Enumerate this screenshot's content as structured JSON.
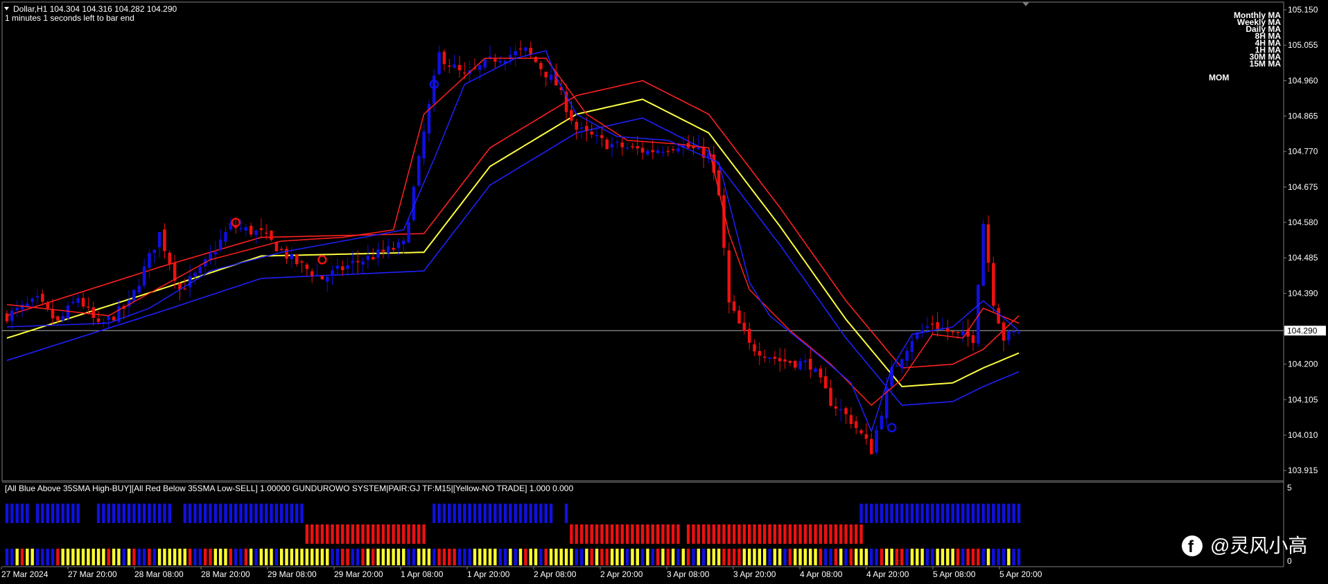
{
  "header": {
    "symbol_line": "Dollar,H1  104.304 104.316 104.282 104.290",
    "timer_line": "1 minutes 1 seconds left to bar end"
  },
  "indicator_header": "[All Blue Above 35SMA High-BUY][All Red Below 35SMA Low-SELL] 1.00000  GUNDUROWO SYSTEM|PAIR:GJ TF:M15|[Yellow-NO TRADE] 1.000 0.000",
  "legend": {
    "items": [
      "Monthly MA",
      "Weekly MA",
      "Daily MA",
      "8H MA",
      "4H MA",
      "1H MA",
      "30M MA",
      "15M MA"
    ],
    "mom": "MOM"
  },
  "sub_axis": {
    "top": "5",
    "bottom": "0"
  },
  "watermark": "@灵风小高",
  "colors": {
    "bull": "#1010e0",
    "bear": "#ee1010",
    "yellow": "#ffff30",
    "ma_blue": "#2020ff",
    "ma_red": "#ff2020",
    "ma_yellow": "#ffff40",
    "grid_line": "#b0b0b0"
  },
  "chart_data": {
    "type": "candlestick",
    "title": "Dollar,H1",
    "y_ticks": [
      "105.150",
      "105.055",
      "104.960",
      "104.865",
      "104.770",
      "104.675",
      "104.580",
      "104.485",
      "104.390",
      "104.290",
      "104.200",
      "104.105",
      "104.010",
      "103.915"
    ],
    "ylim": [
      103.895,
      105.165
    ],
    "current_price": "104.290",
    "x_ticks": [
      "27 Mar 2024",
      "27 Mar 20:00",
      "28 Mar 08:00",
      "28 Mar 20:00",
      "29 Mar 08:00",
      "29 Mar 20:00",
      "1 Apr 08:00",
      "1 Apr 20:00",
      "2 Apr 08:00",
      "2 Apr 20:00",
      "3 Apr 08:00",
      "3 Apr 20:00",
      "4 Apr 08:00",
      "4 Apr 20:00",
      "5 Apr 08:00",
      "5 Apr 20:00"
    ],
    "close_path": [
      [
        0,
        104.33
      ],
      [
        6,
        104.37
      ],
      [
        10,
        104.31
      ],
      [
        14,
        104.38
      ],
      [
        18,
        104.3
      ],
      [
        24,
        104.36
      ],
      [
        30,
        104.55
      ],
      [
        34,
        104.4
      ],
      [
        38,
        104.45
      ],
      [
        44,
        104.57
      ],
      [
        50,
        104.55
      ],
      [
        56,
        104.48
      ],
      [
        62,
        104.43
      ],
      [
        68,
        104.47
      ],
      [
        74,
        104.5
      ],
      [
        78,
        104.52
      ],
      [
        82,
        104.82
      ],
      [
        85,
        105.03
      ],
      [
        90,
        104.97
      ],
      [
        96,
        105.02
      ],
      [
        102,
        105.04
      ],
      [
        108,
        104.95
      ],
      [
        112,
        104.83
      ],
      [
        118,
        104.79
      ],
      [
        126,
        104.77
      ],
      [
        132,
        104.79
      ],
      [
        138,
        104.76
      ],
      [
        140,
        104.65
      ],
      [
        142,
        104.36
      ],
      [
        146,
        104.25
      ],
      [
        152,
        104.21
      ],
      [
        158,
        104.2
      ],
      [
        162,
        104.1
      ],
      [
        166,
        104.05
      ],
      [
        170,
        103.97
      ],
      [
        174,
        104.18
      ],
      [
        178,
        104.27
      ],
      [
        182,
        104.31
      ],
      [
        186,
        104.28
      ],
      [
        190,
        104.27
      ],
      [
        192,
        104.58
      ],
      [
        194,
        104.37
      ],
      [
        196,
        104.27
      ],
      [
        199,
        104.29
      ]
    ],
    "ma_red": [
      [
        0,
        104.36
      ],
      [
        20,
        104.33
      ],
      [
        28,
        104.39
      ],
      [
        40,
        104.48
      ],
      [
        54,
        104.53
      ],
      [
        66,
        104.54
      ],
      [
        76,
        104.56
      ],
      [
        82,
        104.87
      ],
      [
        94,
        105.02
      ],
      [
        106,
        105.02
      ],
      [
        114,
        104.87
      ],
      [
        122,
        104.8
      ],
      [
        132,
        104.79
      ],
      [
        138,
        104.78
      ],
      [
        142,
        104.55
      ],
      [
        146,
        104.4
      ],
      [
        154,
        104.29
      ],
      [
        162,
        104.2
      ],
      [
        170,
        104.09
      ],
      [
        176,
        104.16
      ],
      [
        182,
        104.28
      ],
      [
        188,
        104.27
      ],
      [
        192,
        104.35
      ],
      [
        199,
        104.31
      ]
    ],
    "ma_blue_fast": [
      [
        0,
        104.3
      ],
      [
        20,
        104.31
      ],
      [
        28,
        104.35
      ],
      [
        40,
        104.45
      ],
      [
        54,
        104.5
      ],
      [
        66,
        104.53
      ],
      [
        78,
        104.56
      ],
      [
        84,
        104.75
      ],
      [
        90,
        104.95
      ],
      [
        100,
        105.02
      ],
      [
        106,
        105.04
      ],
      [
        108,
        104.97
      ],
      [
        112,
        104.87
      ],
      [
        120,
        104.81
      ],
      [
        130,
        104.8
      ],
      [
        140,
        104.74
      ],
      [
        146,
        104.42
      ],
      [
        150,
        104.33
      ],
      [
        160,
        104.22
      ],
      [
        166,
        104.15
      ],
      [
        170,
        104.02
      ],
      [
        174,
        104.19
      ],
      [
        178,
        104.28
      ],
      [
        186,
        104.3
      ],
      [
        192,
        104.37
      ],
      [
        199,
        104.29
      ]
    ],
    "envelope_upper": [
      [
        0,
        104.33
      ],
      [
        30,
        104.46
      ],
      [
        50,
        104.54
      ],
      [
        82,
        104.55
      ],
      [
        95,
        104.78
      ],
      [
        112,
        104.92
      ],
      [
        125,
        104.96
      ],
      [
        138,
        104.87
      ],
      [
        152,
        104.62
      ],
      [
        165,
        104.37
      ],
      [
        176,
        104.19
      ],
      [
        186,
        104.2
      ],
      [
        192,
        104.24
      ],
      [
        199,
        104.33
      ]
    ],
    "envelope_mid": [
      [
        0,
        104.27
      ],
      [
        30,
        104.4
      ],
      [
        50,
        104.49
      ],
      [
        82,
        104.5
      ],
      [
        95,
        104.73
      ],
      [
        112,
        104.87
      ],
      [
        125,
        104.91
      ],
      [
        138,
        104.82
      ],
      [
        152,
        104.57
      ],
      [
        165,
        104.32
      ],
      [
        176,
        104.14
      ],
      [
        186,
        104.15
      ],
      [
        192,
        104.19
      ],
      [
        199,
        104.23
      ]
    ],
    "envelope_lower": [
      [
        0,
        104.21
      ],
      [
        30,
        104.34
      ],
      [
        50,
        104.43
      ],
      [
        82,
        104.45
      ],
      [
        95,
        104.68
      ],
      [
        112,
        104.82
      ],
      [
        125,
        104.86
      ],
      [
        138,
        104.77
      ],
      [
        152,
        104.52
      ],
      [
        165,
        104.27
      ],
      [
        176,
        104.09
      ],
      [
        186,
        104.1
      ],
      [
        192,
        104.14
      ],
      [
        199,
        104.18
      ]
    ],
    "signals": [
      [
        45,
        104.58
      ],
      [
        62,
        104.48
      ],
      [
        84,
        104.95
      ],
      [
        174,
        104.03
      ]
    ],
    "sub_rows": {
      "row1": [
        [
          0,
          4,
          "blue"
        ],
        [
          6,
          14,
          "blue"
        ],
        [
          18,
          32,
          "blue"
        ],
        [
          35,
          58,
          "blue"
        ],
        [
          84,
          107,
          "blue"
        ],
        [
          110,
          110,
          "blue"
        ],
        [
          168,
          199,
          "blue"
        ]
      ],
      "row2": [
        [
          59,
          82,
          "red"
        ],
        [
          111,
          132,
          "red"
        ],
        [
          134,
          168,
          "red"
        ]
      ]
    }
  }
}
